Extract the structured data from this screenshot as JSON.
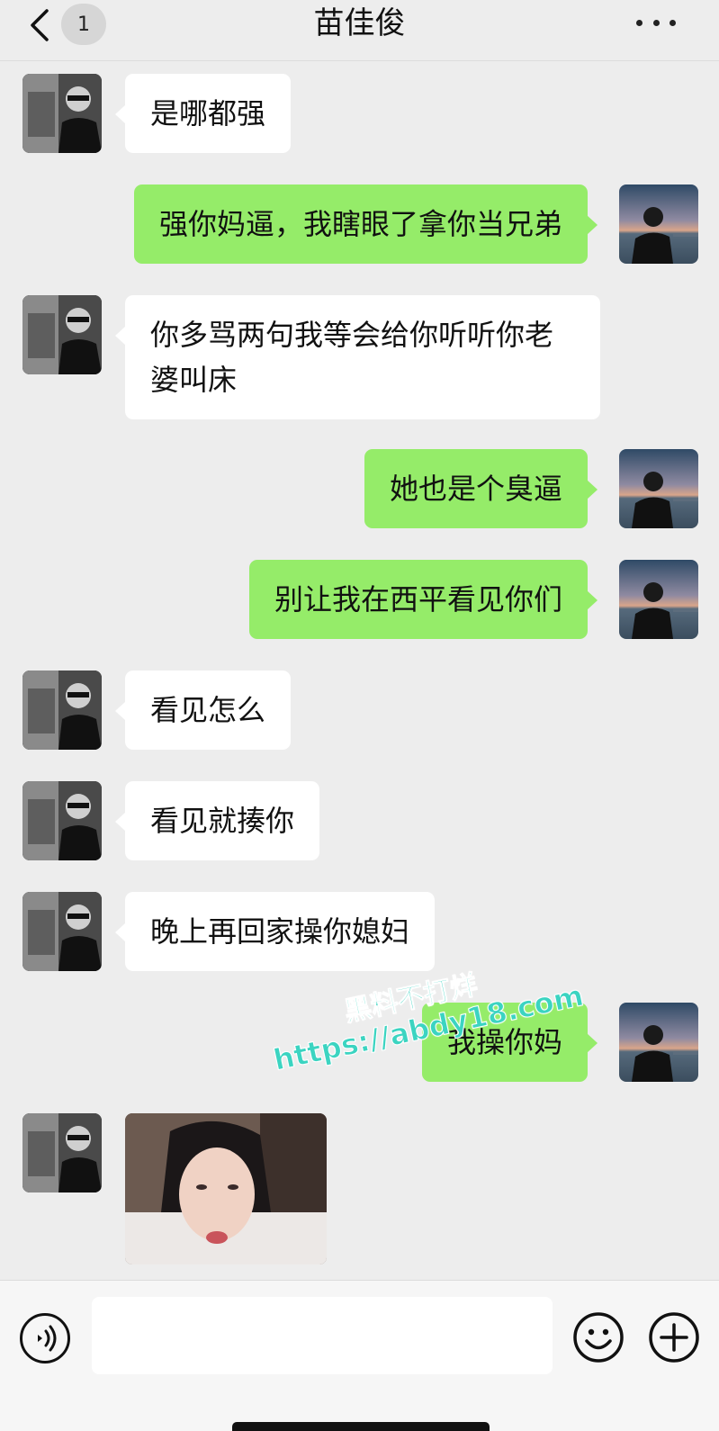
{
  "header": {
    "unread_count": "1",
    "title": "苗佳俊"
  },
  "messages": [
    {
      "from": "other",
      "text": "是哪都强"
    },
    {
      "from": "self",
      "text": "强你妈逼，我瞎眼了拿你当兄弟"
    },
    {
      "from": "other",
      "text": "你多骂两句我等会给你听听你老婆叫床"
    },
    {
      "from": "self",
      "text": "她也是个臭逼"
    },
    {
      "from": "self",
      "text": "别让我在西平看见你们"
    },
    {
      "from": "other",
      "text": "看见怎么"
    },
    {
      "from": "other",
      "text": "看见就揍你"
    },
    {
      "from": "other",
      "text": "晚上再回家操你媳妇"
    },
    {
      "from": "self",
      "text": "我操你妈"
    },
    {
      "from": "other",
      "type": "image"
    }
  ],
  "watermark": {
    "line1": "黑料不打烊",
    "line2": "https://abdy18.com"
  },
  "input_bar": {
    "placeholder": ""
  },
  "colors": {
    "background": "#ededed",
    "self_bubble": "#95ec69",
    "other_bubble": "#ffffff",
    "watermark": "#3bd4c1"
  },
  "icons": [
    "back-chevron-icon",
    "more-dots-icon",
    "voice-icon",
    "emoji-icon",
    "plus-icon"
  ]
}
